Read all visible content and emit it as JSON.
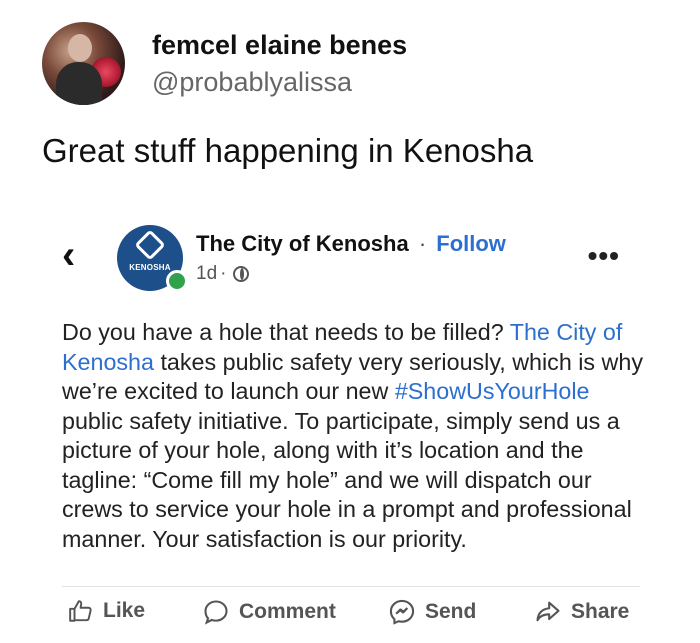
{
  "tweet": {
    "display_name": "femcel elaine benes",
    "handle": "@probablyalissa",
    "text": "Great stuff happening in Kenosha"
  },
  "fb_post": {
    "page_name": "The City of Kenosha",
    "separator": "·",
    "follow_label": "Follow",
    "timestamp": "1d",
    "meta_separator": "·",
    "avatar_logo_text": "KENOSHA",
    "body": {
      "part1": "Do you have a hole that needs to be filled? ",
      "link1": "The City of Kenosha",
      "part2": " takes public safety  very seriously, which is why we’re excited to launch our  new ",
      "hashtag": "#ShowUsYourHole",
      "part3": " public safety initiative.  To participate, simply send us a picture of your hole, along with it’s location and the tagline: “Come fill my hole” and we will dispatch our crews to service your hole in a prompt and professional manner.  Your satisfaction is our priority."
    },
    "actions": {
      "like": "Like",
      "comment": "Comment",
      "send": "Send",
      "share": "Share"
    }
  },
  "icons": {
    "back": "chevron-left-icon",
    "more": "more-horizontal-icon",
    "privacy": "globe-icon",
    "like": "thumbs-up-icon",
    "comment": "comment-bubble-icon",
    "send": "messenger-icon",
    "share": "share-arrow-icon"
  },
  "colors": {
    "link": "#2d6fcf",
    "online": "#31a24c",
    "page_avatar": "#1d4f8a"
  }
}
